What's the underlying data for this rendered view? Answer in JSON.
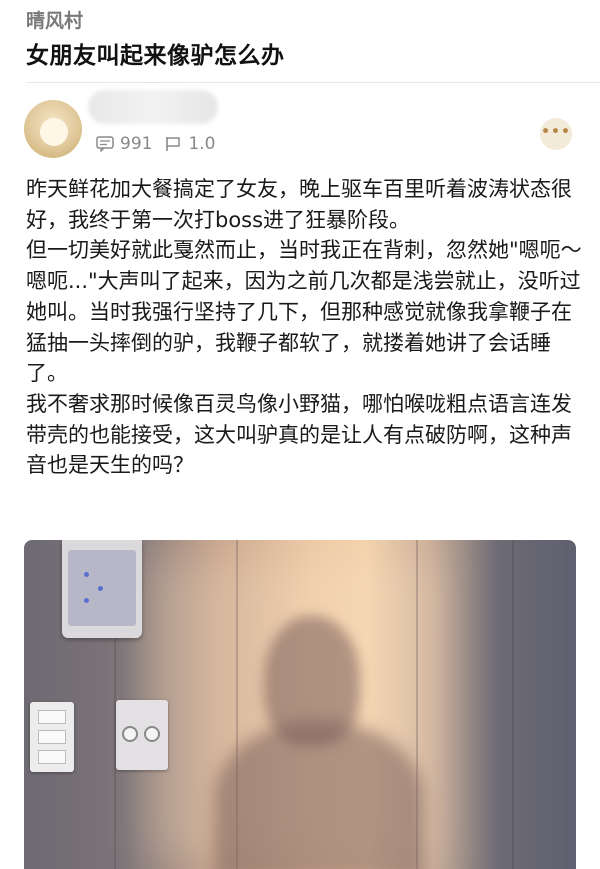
{
  "community": {
    "name": "晴风村"
  },
  "post": {
    "title": "女朋友叫起来像驴怎么办",
    "stats": {
      "comments": "991",
      "rating": "1.0"
    },
    "more_icon": "more-dots-icon",
    "body_paragraphs": [
      "昨天鲜花加大餐搞定了女友，晚上驱车百里听着波涛状态很好，我终于第一次打boss进了狂暴阶段。",
      "但一切美好就此戛然而止，当时我正在背刺，忽然她\"嗯呃～嗯呃...\"大声叫了起来，因为之前几次都是浅尝就止，没听过她叫。当时我强行坚持了几下，但那种感觉就像我拿鞭子在猛抽一头摔倒的驴，我鞭子都软了，就搂着她讲了会话睡了。",
      "我不奢求那时候像百灵鸟像小野猫，哪怕喉咙粗点语言连发带壳的也能接受，这大叫驴真的是让人有点破防啊，这种声音也是天生的吗？"
    ]
  },
  "colors": {
    "title": "#111111",
    "muted": "#888888",
    "more_button_bg": "#f3ead9",
    "more_button_dots": "#b8874a"
  }
}
